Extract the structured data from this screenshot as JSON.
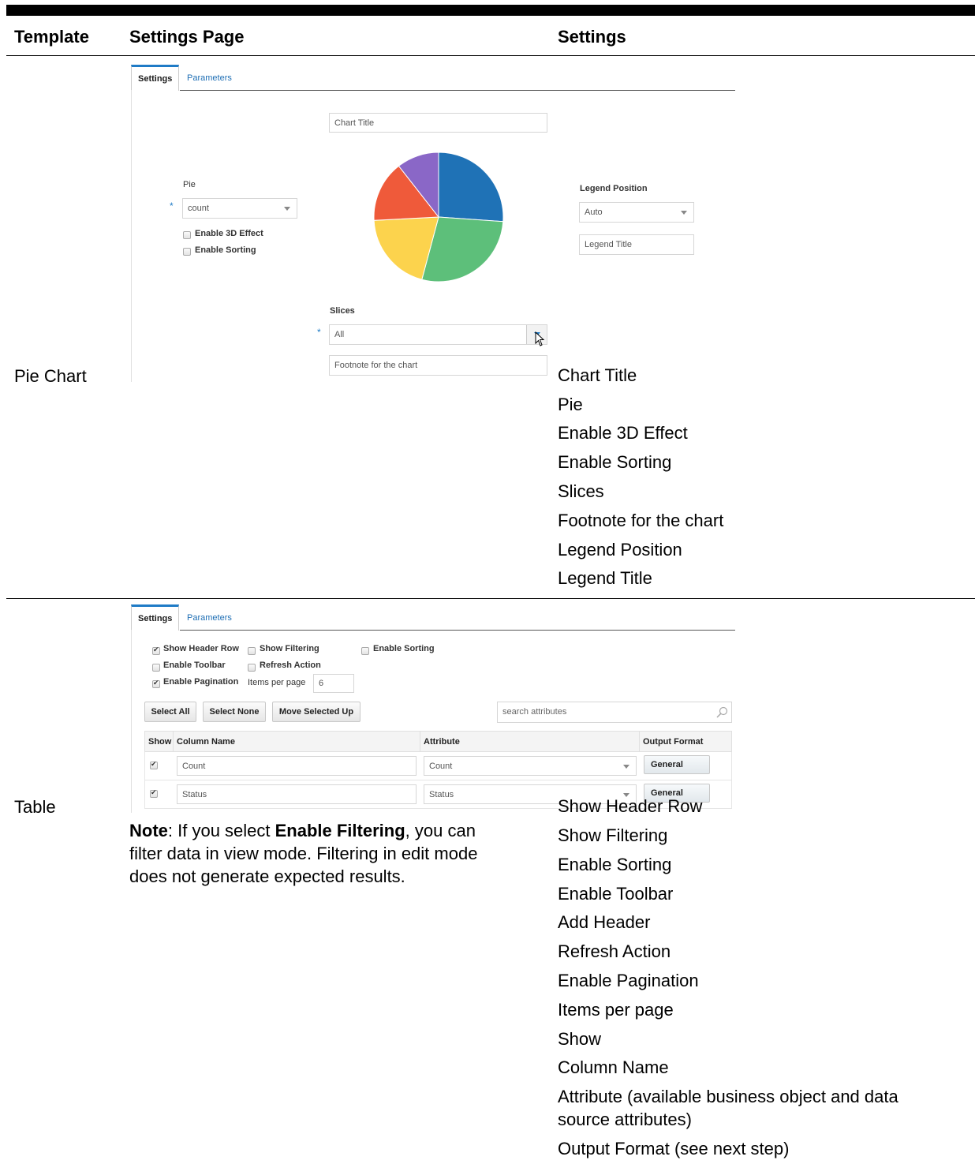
{
  "headers": {
    "template": "Template",
    "settings_page": "Settings Page",
    "settings": "Settings"
  },
  "rows": {
    "pie": {
      "template": "Pie Chart",
      "settings": [
        "Chart Title",
        "Pie",
        "Enable 3D Effect",
        "Enable Sorting",
        "Slices",
        "Footnote for the chart",
        "Legend Position",
        "Legend Title"
      ]
    },
    "table": {
      "template": "Table",
      "settings": [
        "Show Header Row",
        "Show Filtering",
        "Enable Sorting",
        "Enable Toolbar",
        "Add Header",
        "Refresh Action",
        "Enable Pagination",
        "Items per page",
        "Show",
        "Column Name",
        "Attribute (available business object and data",
        "source attributes)",
        "Output Format (see next step)"
      ],
      "note": {
        "label": "Note",
        "pre": ": If you select ",
        "bold": "Enable Filtering",
        "post_line1": ", you can",
        "line2": "filter data in view mode. Filtering in edit mode",
        "line3": "does not generate expected results."
      }
    }
  },
  "pie_shot": {
    "tabs": [
      "Settings",
      "Parameters"
    ],
    "chart_title_placeholder": "Chart Title",
    "pie_label": "Pie",
    "pie_value": "count",
    "enable_3d": "Enable 3D Effect",
    "enable_sorting": "Enable Sorting",
    "legend_position_label": "Legend Position",
    "legend_position_value": "Auto",
    "legend_title_placeholder": "Legend Title",
    "slices_label": "Slices",
    "slices_value": "All",
    "footnote_placeholder": "Footnote for the chart",
    "slice_colors": [
      "#1f72b6",
      "#5dbf7a",
      "#fcd34d",
      "#ef5a3a",
      "#8a67c7"
    ]
  },
  "table_shot": {
    "tabs": [
      "Settings",
      "Parameters"
    ],
    "show_header_row": "Show Header Row",
    "show_filtering": "Show Filtering",
    "enable_sorting": "Enable Sorting",
    "enable_toolbar": "Enable Toolbar",
    "refresh_action": "Refresh Action",
    "enable_pagination": "Enable Pagination",
    "items_per_page": "Items per page",
    "items_per_page_value": "6",
    "select_all": "Select All",
    "select_none": "Select None",
    "move_selected_up": "Move Selected Up",
    "search_placeholder": "search attributes",
    "columns": [
      "Show",
      "Column Name",
      "Attribute",
      "Output Format"
    ],
    "grid_rows": [
      {
        "column_name": "Count",
        "attribute": "Count",
        "format": "General"
      },
      {
        "column_name": "Status",
        "attribute": "Status",
        "format": "General"
      }
    ]
  }
}
